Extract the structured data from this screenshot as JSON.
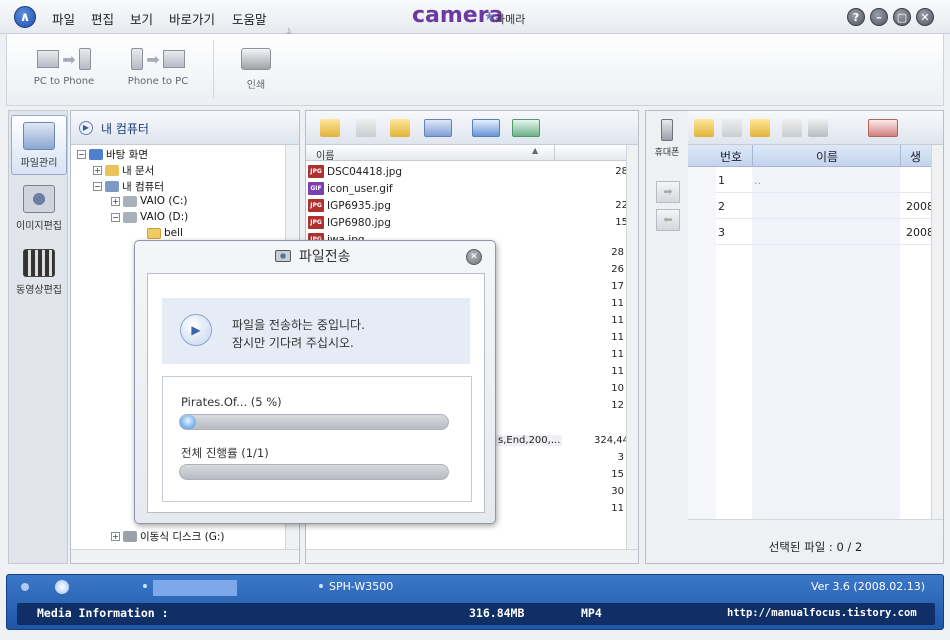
{
  "menu": [
    "파일",
    "편집",
    "보기",
    "바로가기",
    "도움말"
  ],
  "brand": {
    "logo": "camera",
    "sub": "카메라",
    "logo_color": "#6a3aa0"
  },
  "window_buttons": [
    "help-icon",
    "minimize-icon",
    "maximize-icon",
    "close-icon"
  ],
  "toolbar": {
    "pc_to_phone": "PC to Phone",
    "phone_to_pc": "Phone to PC",
    "print": "인쇄"
  },
  "leftnav": [
    "파일관리",
    "이미지편집",
    "동영상편집"
  ],
  "tree": {
    "header": "내 컴퓨터",
    "items": [
      "바탕 화면",
      "내 문서",
      "내 컴퓨터",
      "VAIO (C:)",
      "VAIO (D:)",
      "bell",
      "이동식 디스크 (G:)"
    ]
  },
  "files": {
    "column": "이름",
    "rows": [
      {
        "name": "DSC04418.jpg",
        "type": "JPG",
        "size": "28"
      },
      {
        "name": "icon_user.gif",
        "type": "GIF",
        "size": ""
      },
      {
        "name": "IGP6935.jpg",
        "type": "JPG",
        "size": "22"
      },
      {
        "name": "IGP6980.jpg",
        "type": "JPG",
        "size": "15"
      },
      {
        "name": "iwa.jpg",
        "type": "JPG",
        "size": ""
      }
    ],
    "right_sizes": [
      "28",
      "26",
      "17",
      "11",
      "11",
      "11",
      "11",
      "11",
      "10",
      "12"
    ],
    "partial_name": "s,End,200,...",
    "partial_size": "324,44",
    "lower_sizes": [
      "3",
      "15",
      "30",
      "11"
    ]
  },
  "phone": {
    "label": "휴대폰",
    "columns": [
      "번호",
      "이름",
      "생"
    ],
    "rows": [
      {
        "no": "1",
        "name": "..",
        "date": ""
      },
      {
        "no": "2",
        "name": "",
        "date": "2008"
      },
      {
        "no": "3",
        "name": "",
        "date": "2008"
      }
    ],
    "selected": "선택된 파일 : 0 / 2"
  },
  "status": {
    "model": "SPH-W3500",
    "version": "Ver 3.6 (2008.02.13)",
    "media_label": "Media Information :",
    "media_size": "316.84MB",
    "media_type": "MP4",
    "url": "http://manualfocus.tistory.com"
  },
  "dialog": {
    "title": "파일전송",
    "msg1": "파일을 전송하는 중입니다.",
    "msg2": "잠시만 기다려 주십시오.",
    "file_label": "Pirates.Of...  (5 %)",
    "file_progress": 0.05,
    "total_label": "전체 진행률    (1/1)",
    "total_progress": 0.0
  }
}
